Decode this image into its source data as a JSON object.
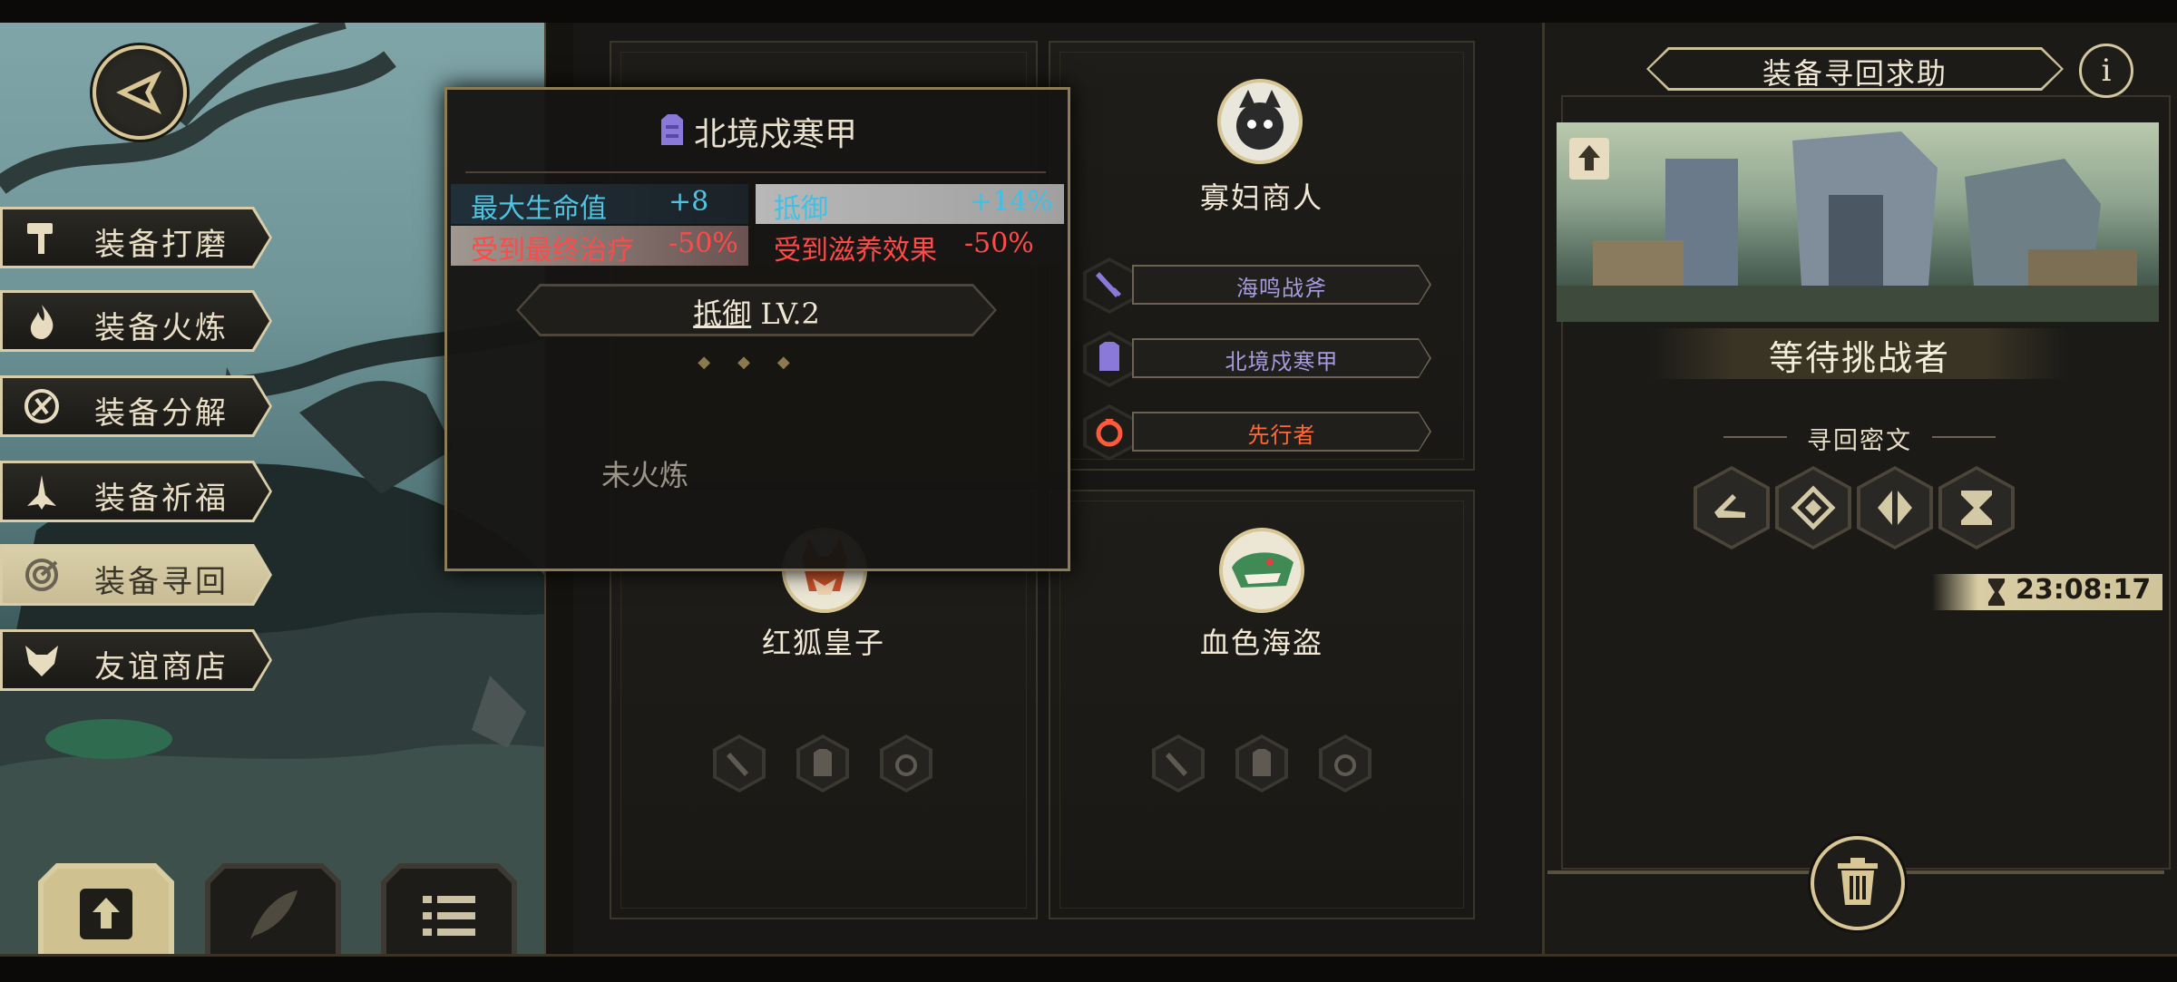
{
  "menu": {
    "items": [
      {
        "label": "装备打磨",
        "icon": "hammer-icon"
      },
      {
        "label": "装备火炼",
        "icon": "flame-icon"
      },
      {
        "label": "装备分解",
        "icon": "disassemble-icon"
      },
      {
        "label": "装备祈福",
        "icon": "pray-icon"
      },
      {
        "label": "装备寻回",
        "icon": "retrieve-icon",
        "active": true
      },
      {
        "label": "友谊商店",
        "icon": "fox-icon"
      }
    ]
  },
  "bottom_tabs": [
    {
      "name": "upload-tab",
      "icon": "upload-icon",
      "active": true
    },
    {
      "name": "feather-tab",
      "icon": "feather-icon"
    },
    {
      "name": "list-tab",
      "icon": "list-icon"
    }
  ],
  "tooltip": {
    "title": "北境戍寒甲",
    "stats": [
      {
        "label": "最大生命值",
        "value": "+8",
        "color": "#4fc3e0"
      },
      {
        "label": "抵御",
        "value": "+14%",
        "color": "#4fc3e0"
      },
      {
        "label": "受到最终治疗",
        "value": "-50%",
        "color": "#ff4a4a"
      },
      {
        "label": "受到滋养效果",
        "value": "-50%",
        "color": "#ff4a4a"
      }
    ],
    "skill_name": "抵御",
    "skill_level": "LV.2",
    "refine_status": "未火炼"
  },
  "characters": {
    "widow": {
      "name": "寡妇商人",
      "equips": [
        {
          "name": "海鸣战斧",
          "color": "#a99be0",
          "icon": "sword-icon"
        },
        {
          "name": "北境戍寒甲",
          "color": "#a99be0",
          "icon": "armor-icon"
        },
        {
          "name": "先行者",
          "color": "#ff6a3a",
          "icon": "ring-icon"
        }
      ]
    },
    "fox": {
      "name": "红狐皇子"
    },
    "pirate": {
      "name": "血色海盗"
    }
  },
  "right_panel": {
    "title": "装备寻回求助",
    "status": "等待挑战者",
    "rune_label": "寻回密文",
    "timer": "23:08:17",
    "runes": [
      "rune-1-icon",
      "rune-2-icon",
      "rune-3-icon",
      "rune-4-icon"
    ]
  },
  "colors": {
    "gold": "#d8c795",
    "stat_blue": "#4fc3e0",
    "stat_red": "#ff4a4a",
    "epic_purple": "#a99be0",
    "legendary_orange": "#ff6a3a"
  }
}
